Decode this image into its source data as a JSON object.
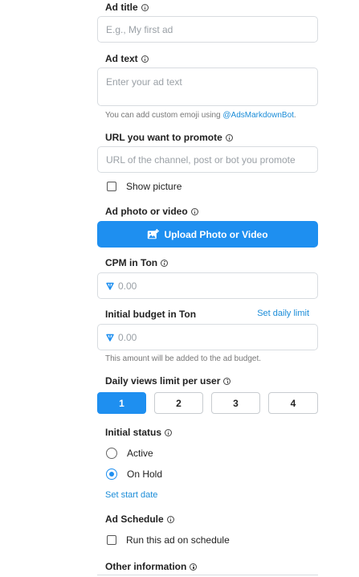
{
  "ad_title": {
    "label": "Ad title",
    "placeholder": "E.g., My first ad"
  },
  "ad_text": {
    "label": "Ad text",
    "placeholder": "Enter your ad text",
    "hint_prefix": "You can add custom emoji using ",
    "hint_link": "@AdsMarkdownBot",
    "hint_suffix": "."
  },
  "url": {
    "label": "URL you want to promote",
    "placeholder": "URL of the channel, post or bot you promote"
  },
  "show_picture": {
    "label": "Show picture",
    "checked": false
  },
  "media": {
    "label": "Ad photo or video",
    "button_label": "Upload Photo or Video"
  },
  "cpm": {
    "label": "CPM in Ton",
    "placeholder": "0.00"
  },
  "budget": {
    "label": "Initial budget in Ton",
    "daily_limit_link": "Set daily limit",
    "placeholder": "0.00",
    "hint": "This amount will be added to the ad budget."
  },
  "daily_views": {
    "label": "Daily views limit per user",
    "options": [
      "1",
      "2",
      "3",
      "4"
    ],
    "selected": "1"
  },
  "initial_status": {
    "label": "Initial status",
    "options": [
      {
        "label": "Active",
        "checked": false
      },
      {
        "label": "On Hold",
        "checked": true
      }
    ],
    "start_date_link": "Set start date"
  },
  "schedule": {
    "label": "Ad Schedule",
    "checkbox_label": "Run this ad on schedule",
    "checked": false
  },
  "other": {
    "label": "Other information"
  },
  "colors": {
    "accent": "#1e8ff0",
    "link": "#1a8cd8",
    "border": "#d8dce0"
  }
}
